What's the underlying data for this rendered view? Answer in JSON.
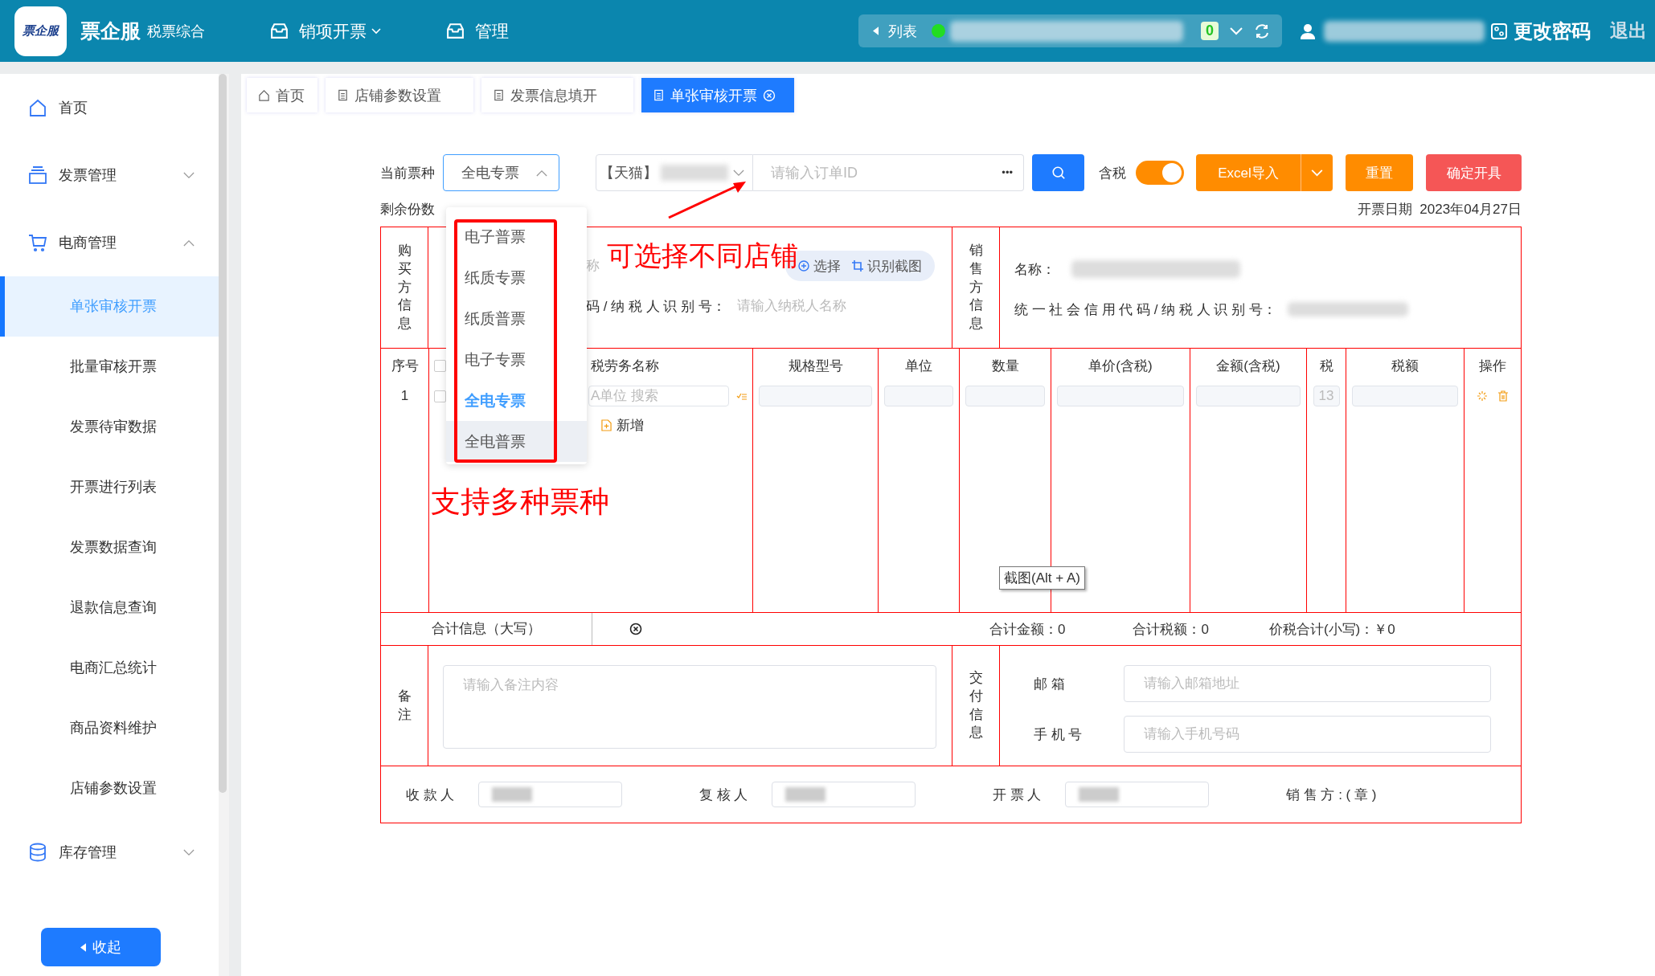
{
  "header": {
    "logo_text": "票企服",
    "brand": "票企服",
    "subtitle": "税票综合",
    "nav": [
      {
        "label": "销项开票",
        "dropdown": true
      },
      {
        "label": "管理",
        "dropdown": false
      }
    ],
    "store_bar": {
      "label": "列表",
      "count": "0"
    },
    "change_password": "更改密码",
    "logout": "退出"
  },
  "sidebar": {
    "items": [
      {
        "label": "首页"
      },
      {
        "label": "发票管理",
        "expanded": false
      },
      {
        "label": "电商管理",
        "expanded": true,
        "children": [
          {
            "label": "单张审核开票",
            "selected": true
          },
          {
            "label": "批量审核开票",
            "selected": false
          },
          {
            "label": "发票待审数据",
            "selected": false
          },
          {
            "label": "开票进行列表",
            "selected": false
          },
          {
            "label": "发票数据查询",
            "selected": false
          },
          {
            "label": "退款信息查询",
            "selected": false
          },
          {
            "label": "电商汇总统计",
            "selected": false
          },
          {
            "label": "商品资料维护",
            "selected": false
          },
          {
            "label": "店铺参数设置",
            "selected": false
          }
        ]
      },
      {
        "label": "库存管理",
        "expanded": false
      }
    ],
    "collapse_button": "收起"
  },
  "tabs": [
    {
      "label": "首页",
      "selected": false
    },
    {
      "label": "店铺参数设置",
      "selected": false
    },
    {
      "label": "发票信息填开",
      "selected": false
    },
    {
      "label": "单张审核开票",
      "selected": true
    }
  ],
  "toolbar": {
    "ticket_type_label": "当前票种",
    "ticket_type": "全电专票",
    "store": "【天猫】",
    "order_placeholder": "请输入订单ID",
    "more": "•••",
    "tax_included_label": "含税",
    "tax_included": true,
    "excel_import": "Excel导入",
    "reset": "重置",
    "confirm": "确定开具"
  },
  "remaining_label": "剩余份数",
  "date_label": "开票日期",
  "date": "2023年04月27日",
  "ticket_dropdown": {
    "options": [
      {
        "label": "电子普票",
        "selected": false,
        "hovered": false
      },
      {
        "label": "纸质专票",
        "selected": false,
        "hovered": false
      },
      {
        "label": "纸质普票",
        "selected": false,
        "hovered": false
      },
      {
        "label": "电子专票",
        "selected": false,
        "hovered": false
      },
      {
        "label": "全电专票",
        "selected": true,
        "hovered": false
      },
      {
        "label": "全电普票",
        "selected": false,
        "hovered": true
      }
    ]
  },
  "buyer": {
    "heading": "购买方信息",
    "name_placeholder": "称",
    "select": "选择",
    "recognize": "识别截图",
    "tax_id_label": "码 / 纳 税 人 识 别 号：",
    "tax_id_placeholder": "请输入纳税人名称"
  },
  "seller": {
    "heading": "销售方信息",
    "name_label": "名称：",
    "tax_id_label": "统 一 社 会 信 用 代 码 / 纳 税 人 识 别 号："
  },
  "items": {
    "columns": [
      "序号",
      "税劳务名称",
      "规格型号",
      "单位",
      "数量",
      "单价(含税)",
      "金额(含税)",
      "税",
      "税额",
      "操作"
    ],
    "all_checked": false,
    "rows": [
      {
        "index": "1",
        "checked": false,
        "name_placeholder": "A单位 搜索",
        "tax_rate": "13"
      }
    ],
    "add_label": "新增"
  },
  "totals": {
    "uppercase_label": "合计信息（大写）",
    "amount": "合计金额：0",
    "tax": "合计税额：0",
    "total": "价税合计(小写)：￥0"
  },
  "remarks": {
    "label": "备注",
    "placeholder": "请输入备注内容"
  },
  "delivery": {
    "label": "交付信息",
    "email_label": "邮 箱",
    "email_placeholder": "请输入邮箱地址",
    "phone_label": "手 机 号",
    "phone_placeholder": "请输入手机号码"
  },
  "signatures": [
    "收 款 人",
    "复 核 人",
    "开 票 人"
  ],
  "seller_stamp": "销 售 方 : ( 章 )",
  "annotations": [
    "可选择不同店铺",
    "支持多种票种"
  ],
  "tooltip": "截图(Alt + A)"
}
